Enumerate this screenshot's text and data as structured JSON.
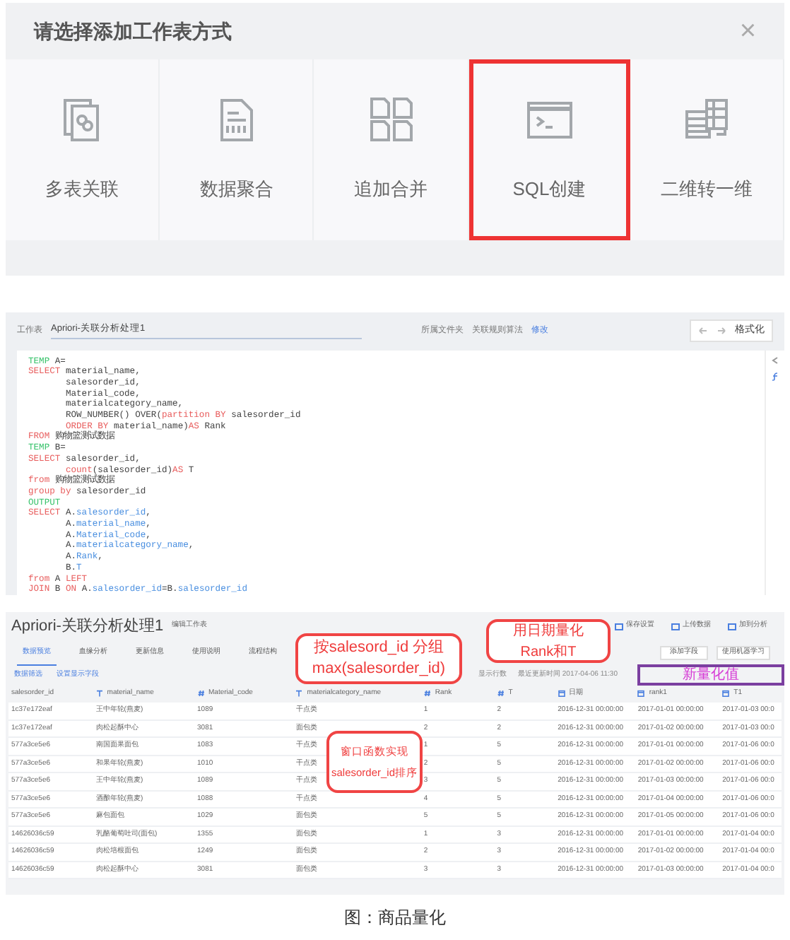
{
  "dialog": {
    "title": "请选择添加工作表方式",
    "close": "×",
    "options": [
      {
        "label": "多表关联",
        "kind": "join",
        "selected": false
      },
      {
        "label": "数据聚合",
        "kind": "aggregate",
        "selected": false
      },
      {
        "label": "追加合并",
        "kind": "append",
        "selected": false
      },
      {
        "label": "SQL创建",
        "kind": "sql",
        "selected": true
      },
      {
        "label": "二维转一维",
        "kind": "pivot",
        "selected": false
      }
    ]
  },
  "editor": {
    "sheet_label": "工作表",
    "sheet_name": "Apriori-关联分析处理1",
    "folder_label": "所属文件夹",
    "folder": "关联规则算法",
    "edit_link": "修改",
    "format_button": "格式化",
    "lines": [
      [
        {
          "t": "TEMP ",
          "kind": "tmp"
        },
        {
          "t": "A=",
          "kind": "text"
        }
      ],
      [
        {
          "t": "SELECT ",
          "kind": "kw"
        },
        {
          "t": "material_name,",
          "kind": "text"
        }
      ],
      [
        {
          "t": "       salesorder_id,",
          "kind": "text"
        }
      ],
      [
        {
          "t": "       Material_code,",
          "kind": "text"
        }
      ],
      [
        {
          "t": "       materialcategory_name,",
          "kind": "text"
        }
      ],
      [
        {
          "t": "       ROW_NUMBER() OVER(",
          "kind": "text"
        },
        {
          "t": "partition BY ",
          "kind": "kw"
        },
        {
          "t": "salesorder_id",
          "kind": "text"
        }
      ],
      [
        {
          "t": "       ORDER BY ",
          "kind": "kw"
        },
        {
          "t": "material_name)",
          "kind": "text"
        },
        {
          "t": "AS ",
          "kind": "kw"
        },
        {
          "t": "Rank",
          "kind": "text"
        }
      ],
      [
        {
          "t": "FROM ",
          "kind": "kw"
        },
        {
          "t": "购物篮测试数据",
          "kind": "text"
        }
      ],
      [
        {
          "t": "TEMP ",
          "kind": "tmp"
        },
        {
          "t": "B=",
          "kind": "text"
        }
      ],
      [
        {
          "t": "SELECT ",
          "kind": "kw"
        },
        {
          "t": "salesorder_id,",
          "kind": "text"
        }
      ],
      [
        {
          "t": "       count",
          "kind": "kw"
        },
        {
          "t": "(salesorder_id)",
          "kind": "text"
        },
        {
          "t": "AS ",
          "kind": "kw"
        },
        {
          "t": "T",
          "kind": "text"
        }
      ],
      [
        {
          "t": "from ",
          "kind": "kw"
        },
        {
          "t": "购物篮测试数据",
          "kind": "text"
        }
      ],
      [
        {
          "t": "group by ",
          "kind": "kw"
        },
        {
          "t": "salesorder_id",
          "kind": "text"
        }
      ],
      [
        {
          "t": "OUTPUT",
          "kind": "tmp"
        }
      ],
      [
        {
          "t": "SELECT ",
          "kind": "kw"
        },
        {
          "t": "A.",
          "kind": "text"
        },
        {
          "t": "salesorder_id",
          "kind": "field"
        },
        {
          "t": ",",
          "kind": "text"
        }
      ],
      [
        {
          "t": "       A.",
          "kind": "text"
        },
        {
          "t": "material_name",
          "kind": "field"
        },
        {
          "t": ",",
          "kind": "text"
        }
      ],
      [
        {
          "t": "       A.",
          "kind": "text"
        },
        {
          "t": "Material_code",
          "kind": "field"
        },
        {
          "t": ",",
          "kind": "text"
        }
      ],
      [
        {
          "t": "       A.",
          "kind": "text"
        },
        {
          "t": "materialcategory_name",
          "kind": "field"
        },
        {
          "t": ",",
          "kind": "text"
        }
      ],
      [
        {
          "t": "       A.",
          "kind": "text"
        },
        {
          "t": "Rank",
          "kind": "field"
        },
        {
          "t": ",",
          "kind": "text"
        }
      ],
      [
        {
          "t": "       B.",
          "kind": "text"
        },
        {
          "t": "T",
          "kind": "field"
        }
      ],
      [
        {
          "t": "from ",
          "kind": "kw"
        },
        {
          "t": "A ",
          "kind": "text"
        },
        {
          "t": "LEFT",
          "kind": "kw"
        }
      ],
      [
        {
          "t": "JOIN ",
          "kind": "kw"
        },
        {
          "t": "B ",
          "kind": "text"
        },
        {
          "t": "ON ",
          "kind": "kw"
        },
        {
          "t": "A.",
          "kind": "text"
        },
        {
          "t": "salesorder_id",
          "kind": "field"
        },
        {
          "t": "=B.",
          "kind": "text"
        },
        {
          "t": "salesorder_id",
          "kind": "field"
        }
      ]
    ]
  },
  "sheet": {
    "title": "Apriori-关联分析处理1",
    "edit_label": "编辑工作表",
    "actions": [
      "保存设置",
      "上传数据",
      "加到分析"
    ],
    "tabs": [
      {
        "label": "数据预览",
        "selected": true
      },
      {
        "label": "血缘分析",
        "selected": false
      },
      {
        "label": "更新信息",
        "selected": false
      },
      {
        "label": "使用说明",
        "selected": false
      },
      {
        "label": "流程结构",
        "selected": false
      }
    ],
    "filters": [
      "数据筛选",
      "设置显示字段"
    ],
    "add_field": "添加字段",
    "ml_button": "使用机器学习",
    "info": [
      "显示行数",
      "最近更新时间 2017-04-06 11:30"
    ],
    "columns": [
      {
        "name": "salesorder_id",
        "kind": "none"
      },
      {
        "name": "material_name",
        "kind": "text"
      },
      {
        "name": "Material_code",
        "kind": "number"
      },
      {
        "name": "materialcategory_name",
        "kind": "text"
      },
      {
        "name": "Rank",
        "kind": "number"
      },
      {
        "name": "T",
        "kind": "number"
      },
      {
        "name": "日期",
        "kind": "date"
      },
      {
        "name": "rank1",
        "kind": "date"
      },
      {
        "name": "T1",
        "kind": "date"
      }
    ],
    "rows": [
      [
        "1c37e172eaf",
        "王中年轮(燕麦)",
        "1089",
        "干点类",
        "1",
        "2",
        "2016-12-31 00:00:00",
        "2017-01-01 00:00:00",
        "2017-01-03 00:0"
      ],
      [
        "1c37e172eaf",
        "肉松起酥中心",
        "3081",
        "面包类",
        "2",
        "2",
        "2016-12-31 00:00:00",
        "2017-01-02 00:00:00",
        "2017-01-03 00:0"
      ],
      [
        "577a3ce5e6",
        "南国面果面包",
        "1083",
        "干点类",
        "1",
        "5",
        "2016-12-31 00:00:00",
        "2017-01-01 00:00:00",
        "2017-01-06 00:0"
      ],
      [
        "577a3ce5e6",
        "和果年轮(燕麦)",
        "1010",
        "干点类",
        "2",
        "5",
        "2016-12-31 00:00:00",
        "2017-01-02 00:00:00",
        "2017-01-06 00:0"
      ],
      [
        "577a3ce5e6",
        "王中年轮(燕麦)",
        "1089",
        "干点类",
        "3",
        "5",
        "2016-12-31 00:00:00",
        "2017-01-03 00:00:00",
        "2017-01-06 00:0"
      ],
      [
        "577a3ce5e6",
        "酒酿年轮(燕麦)",
        "1088",
        "干点类",
        "4",
        "5",
        "2016-12-31 00:00:00",
        "2017-01-04 00:00:00",
        "2017-01-06 00:0"
      ],
      [
        "577a3ce5e6",
        "麻包面包",
        "1029",
        "面包类",
        "5",
        "5",
        "2016-12-31 00:00:00",
        "2017-01-05 00:00:00",
        "2017-01-06 00:0"
      ],
      [
        "14626036c59",
        "乳酪葡萄吐司(面包)",
        "1355",
        "面包类",
        "1",
        "3",
        "2016-12-31 00:00:00",
        "2017-01-01 00:00:00",
        "2017-01-04 00:0"
      ],
      [
        "14626036c59",
        "肉松培根面包",
        "1249",
        "面包类",
        "2",
        "3",
        "2016-12-31 00:00:00",
        "2017-01-02 00:00:00",
        "2017-01-04 00:0"
      ],
      [
        "14626036c59",
        "肉松起酥中心",
        "3081",
        "面包类",
        "3",
        "3",
        "2016-12-31 00:00:00",
        "2017-01-03 00:00:00",
        "2017-01-04 00:0"
      ]
    ],
    "callouts": [
      {
        "kind": "note",
        "lines": [
          "按salesord_id 分组",
          "max(salesorder_id)"
        ]
      },
      {
        "kind": "note",
        "lines": [
          "窗口函数实现",
          "salesorder_id排序"
        ]
      },
      {
        "kind": "note",
        "lines": [
          "用日期量化",
          "Rank和T"
        ]
      },
      {
        "kind": "highlight",
        "lines": [
          "新量化值"
        ]
      }
    ]
  },
  "caption": "图：商品量化"
}
